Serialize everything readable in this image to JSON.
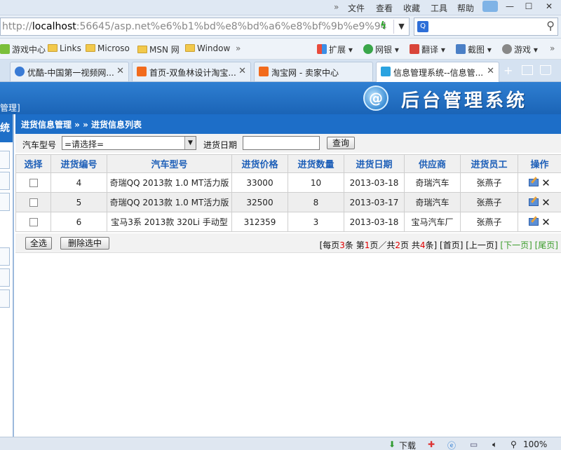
{
  "browser": {
    "menu": {
      "chevron": "»",
      "items": [
        "文件",
        "查看",
        "收藏",
        "工具",
        "帮助"
      ]
    },
    "window_controls": {
      "minimize": "—",
      "maximize": "☐",
      "close": "✕"
    },
    "address": {
      "scheme": "http://",
      "host": "localhost",
      "rest": ":56645/asp.net%e6%b1%bd%e8%bd%a6%e8%bf%9b%e9%94"
    },
    "favorites": [
      {
        "label": "游戏中心",
        "icon": "game-icon"
      },
      {
        "label": "Links",
        "icon": "folder-icon"
      },
      {
        "label": "Microso",
        "icon": "folder-icon"
      },
      {
        "label": "MSN 网",
        "icon": "folder-icon"
      },
      {
        "label": "Window",
        "icon": "folder-icon"
      }
    ],
    "favorites_more": "»",
    "toolbar": [
      {
        "label": "扩展",
        "icon": "extension-icon"
      },
      {
        "label": "网银",
        "icon": "bank-icon"
      },
      {
        "label": "翻译",
        "icon": "translate-icon"
      },
      {
        "label": "截图",
        "icon": "screenshot-icon"
      },
      {
        "label": "游戏",
        "icon": "gamepad-icon"
      }
    ],
    "toolbar_more": "»",
    "tabs": [
      {
        "label": "优酷-中国第一视频网...",
        "active": false,
        "color": "#3a7bd5"
      },
      {
        "label": "首页-双鱼林设计淘宝...",
        "active": false,
        "color": "#f26b1d"
      },
      {
        "label": "淘宝网 - 卖家中心",
        "active": false,
        "color": "#f26b1d"
      },
      {
        "label": "信息管理系统--信息管...",
        "active": true,
        "color": "#2aa3e0"
      }
    ],
    "status": {
      "download": "下载",
      "zoom": "100%"
    }
  },
  "app": {
    "title": "后台管理系统",
    "logo_letter": "@",
    "side_tag": "管理]",
    "sidebar_head": "统",
    "breadcrumb": "进货信息管理 » » 进货信息列表",
    "filter": {
      "car_model_label": "汽车型号",
      "car_model_value": "=请选择=",
      "date_label": "进货日期",
      "date_value": "",
      "query_button": "查询"
    },
    "table": {
      "headers": [
        "选择",
        "进货编号",
        "汽车型号",
        "进货价格",
        "进货数量",
        "进货日期",
        "供应商",
        "进货员工",
        "操作"
      ],
      "rows": [
        {
          "id": "4",
          "model": "奇瑞QQ 2013款 1.0 MT活力版",
          "price": "33000",
          "qty": "10",
          "date": "2013-03-18",
          "supplier": "奇瑞汽车",
          "staff": "张燕子"
        },
        {
          "id": "5",
          "model": "奇瑞QQ 2013款 1.0 MT活力版",
          "price": "32500",
          "qty": "8",
          "date": "2013-03-17",
          "supplier": "奇瑞汽车",
          "staff": "张燕子"
        },
        {
          "id": "6",
          "model": "宝马3系 2013款 320Li 手动型",
          "price": "312359",
          "qty": "3",
          "date": "2013-03-18",
          "supplier": "宝马汽车厂",
          "staff": "张燕子"
        }
      ]
    },
    "actions": {
      "select_all": "全选",
      "delete_selected": "删除选中"
    },
    "pager": {
      "per_page_pre": "[每页",
      "per_page": "3",
      "per_page_post": "条 第",
      "current": "1",
      "current_post": "页／共",
      "total_pages": "2",
      "total_pages_post": "页 共",
      "total_items": "4",
      "total_items_post": "条]",
      "first": "[首页]",
      "prev": "[上一页]",
      "next": "[下一页]",
      "last": "[尾页]"
    }
  }
}
